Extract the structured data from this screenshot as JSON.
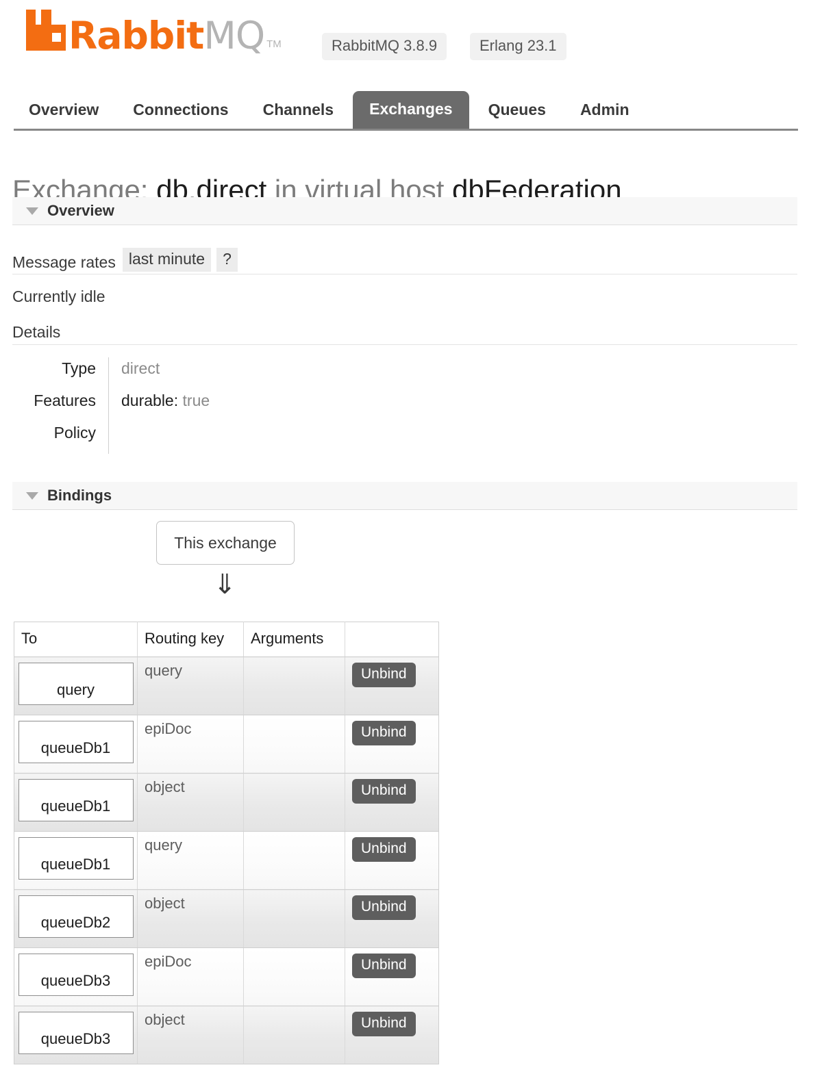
{
  "header": {
    "logo_rabbit": "Rabbit",
    "logo_mq": "MQ",
    "logo_tm": "TM",
    "rabbitmq_version": "RabbitMQ 3.8.9",
    "erlang_version": "Erlang 23.1"
  },
  "nav": {
    "items": [
      {
        "label": "Overview",
        "active": false
      },
      {
        "label": "Connections",
        "active": false
      },
      {
        "label": "Channels",
        "active": false
      },
      {
        "label": "Exchanges",
        "active": true
      },
      {
        "label": "Queues",
        "active": false
      },
      {
        "label": "Admin",
        "active": false
      }
    ]
  },
  "page": {
    "title_prefix": "Exchange:",
    "exchange_name": "db.direct",
    "title_middle": "in virtual host",
    "vhost_name": "dbFederation"
  },
  "overview": {
    "section_title": "Overview",
    "message_rates_label": "Message rates",
    "rate_tab_period": "last minute",
    "rate_tab_help": "?",
    "idle_text": "Currently idle",
    "details_label": "Details",
    "details": {
      "type_label": "Type",
      "type_value": "direct",
      "features_label": "Features",
      "features_key": "durable:",
      "features_value": "true",
      "policy_label": "Policy",
      "policy_value": ""
    }
  },
  "bindings": {
    "section_title": "Bindings",
    "this_exchange_label": "This exchange",
    "flow_arrow": "⇓",
    "columns": [
      "To",
      "Routing key",
      "Arguments",
      ""
    ],
    "unbind_label": "Unbind",
    "rows": [
      {
        "to": "query",
        "routing_key": "query",
        "arguments": ""
      },
      {
        "to": "queueDb1",
        "routing_key": "epiDoc",
        "arguments": ""
      },
      {
        "to": "queueDb1",
        "routing_key": "object",
        "arguments": ""
      },
      {
        "to": "queueDb1",
        "routing_key": "query",
        "arguments": ""
      },
      {
        "to": "queueDb2",
        "routing_key": "object",
        "arguments": ""
      },
      {
        "to": "queueDb3",
        "routing_key": "epiDoc",
        "arguments": ""
      },
      {
        "to": "queueDb3",
        "routing_key": "object",
        "arguments": ""
      }
    ]
  },
  "colors": {
    "brand_orange": "#f36d12",
    "logo_gray": "#b4b4b4",
    "active_tab": "#6b6b6b",
    "unbind_button": "#5e5e5e"
  }
}
